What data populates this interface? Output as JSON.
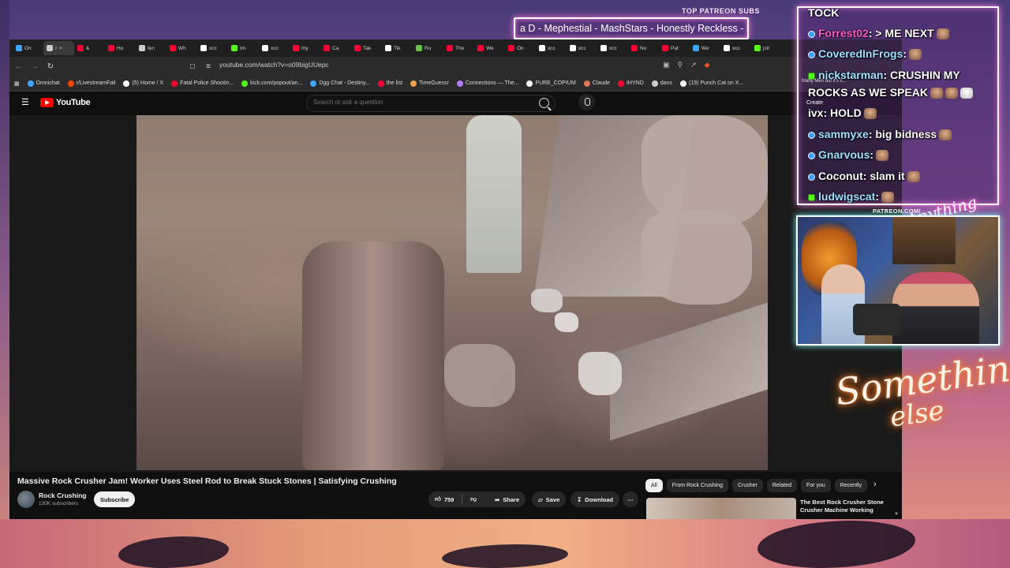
{
  "overlay": {
    "top_patreon_label": "TOP PATREON SUBS",
    "marquee_text": "a D - Mephestial - MashStars - Honestly Reckless - Moot E",
    "patreon_label": "PATREON.COM/",
    "patreon_script": "Anything else",
    "signature_line1": "Something",
    "signature_line2": "else",
    "colors": {
      "neon_pink": "#ff7de9",
      "neon_orange": "#ff6a00"
    }
  },
  "browser": {
    "tabs": [
      {
        "label": "On",
        "color": "#3ea6ff",
        "active": false
      },
      {
        "label": "I",
        "color": "#cccccc",
        "active": true
      },
      {
        "label": "&",
        "color": "#ff0033",
        "active": false
      },
      {
        "label": "Ho",
        "color": "#ff0033",
        "active": false
      },
      {
        "label": "fen",
        "color": "#cccccc",
        "active": false
      },
      {
        "label": "Wh",
        "color": "#ff0033",
        "active": false
      },
      {
        "label": "xcc",
        "color": "#ffffff",
        "active": false
      },
      {
        "label": "Im",
        "color": "#53fc18",
        "active": false
      },
      {
        "label": "xcc",
        "color": "#ffffff",
        "active": false
      },
      {
        "label": "my",
        "color": "#ff0033",
        "active": false
      },
      {
        "label": "Ca",
        "color": "#ff0033",
        "active": false
      },
      {
        "label": "Tak",
        "color": "#ff0033",
        "active": false
      },
      {
        "label": "Tik",
        "color": "#ffffff",
        "active": false
      },
      {
        "label": "Ru",
        "color": "#6cc04a",
        "active": false
      },
      {
        "label": "The",
        "color": "#ff0033",
        "active": false
      },
      {
        "label": "We",
        "color": "#ff0033",
        "active": false
      },
      {
        "label": "On",
        "color": "#ff0033",
        "active": false
      },
      {
        "label": "xcc",
        "color": "#ffffff",
        "active": false
      },
      {
        "label": "xcc",
        "color": "#ffffff",
        "active": false
      },
      {
        "label": "xcc",
        "color": "#ffffff",
        "active": false
      },
      {
        "label": "No",
        "color": "#ff0033",
        "active": false
      },
      {
        "label": "Pat",
        "color": "#ff0033",
        "active": false
      },
      {
        "label": "We",
        "color": "#3ea6ff",
        "active": false
      },
      {
        "label": "xcc",
        "color": "#ffffff",
        "active": false
      },
      {
        "label": "jstl",
        "color": "#53fc18",
        "active": false
      }
    ],
    "url": "youtube.com/watch?v=o09bigUUepc",
    "bookmarks": [
      {
        "label": "Omnichat",
        "color": "#3ea6ff"
      },
      {
        "label": "r/LivestreamFail",
        "color": "#ff4500"
      },
      {
        "label": "(5) Home / X",
        "color": "#ffffff"
      },
      {
        "label": "Fatal Police Shootin...",
        "color": "#ff0033"
      },
      {
        "label": "kick.com/popout/an...",
        "color": "#53fc18"
      },
      {
        "label": "Dgg Chat - Destiny...",
        "color": "#3ea6ff"
      },
      {
        "label": "the list",
        "color": "#ff0033"
      },
      {
        "label": "TimeGuessr",
        "color": "#f0a050"
      },
      {
        "label": "Connections — The...",
        "color": "#b47cff"
      },
      {
        "label": "PURE_COPIUM",
        "color": "#ffffff"
      },
      {
        "label": "Claude",
        "color": "#d97757"
      },
      {
        "label": "IHYND",
        "color": "#ff0033"
      },
      {
        "label": "dans",
        "color": "#cccccc"
      },
      {
        "label": "(19) Punch Cat on X...",
        "color": "#ffffff"
      }
    ]
  },
  "youtube": {
    "logo_text": "YouTube",
    "search_placeholder": "Search or ask a question",
    "video": {
      "title": "Massive Rock Crusher Jam! Worker Uses Steel Rod to Break Stuck Stones | Satisfying Crushing",
      "channel": "Rock Crushing",
      "subscribers": "130K subscribers",
      "subscribe_label": "Subscribe",
      "likes": "759",
      "share_label": "Share",
      "save_label": "Save",
      "download_label": "Download"
    },
    "chips": [
      "All",
      "From Rock Crushing",
      "Crusher",
      "Related",
      "For you",
      "Recently"
    ],
    "recommended": {
      "title": "The Best Rock Crusher Stone Crusher Machine Working"
    }
  },
  "chat": {
    "messages": [
      {
        "user": "TOCK",
        "user_color": "#ffffff",
        "text": "",
        "badge": "none",
        "emotes": 0
      },
      {
        "user": "Forrest02",
        "user_color": "#ff5cc8",
        "text": ": > ME NEXT",
        "badge": "yt",
        "emotes": 1
      },
      {
        "user": "CoveredInFrogs",
        "user_color": "#9fe0ff",
        "text": ":",
        "badge": "yt",
        "emotes": 1
      },
      {
        "user": "nickstarman",
        "user_color": "#9fe0ff",
        "text": ": CRUSHIN MY",
        "badge": "kick",
        "emotes": 0
      },
      {
        "user": "",
        "user_color": "#ffffff",
        "text": "ROCKS AS WE SPEAK",
        "badge": "none",
        "emotes": 3
      },
      {
        "user": "ivx",
        "user_color": "#ffffff",
        "text": ": HOLD",
        "badge": "none",
        "emotes": 1
      },
      {
        "user": "sammyxe",
        "user_color": "#9fe0ff",
        "text": ": big bidness",
        "badge": "yt",
        "emotes": 1
      },
      {
        "user": "Gnarvous",
        "user_color": "#9fe0ff",
        "text": ":",
        "badge": "yt",
        "emotes": 1
      },
      {
        "user": "Coconut",
        "user_color": "#ffffff",
        "text": ": slam it",
        "badge": "yt",
        "emotes": 1
      },
      {
        "user": "ludwigscat",
        "user_color": "#9fe0ff",
        "text": ":",
        "badge": "kick",
        "emotes": 1
      }
    ],
    "mini_text": "Many Men but it's s...",
    "create_label": "Create"
  }
}
